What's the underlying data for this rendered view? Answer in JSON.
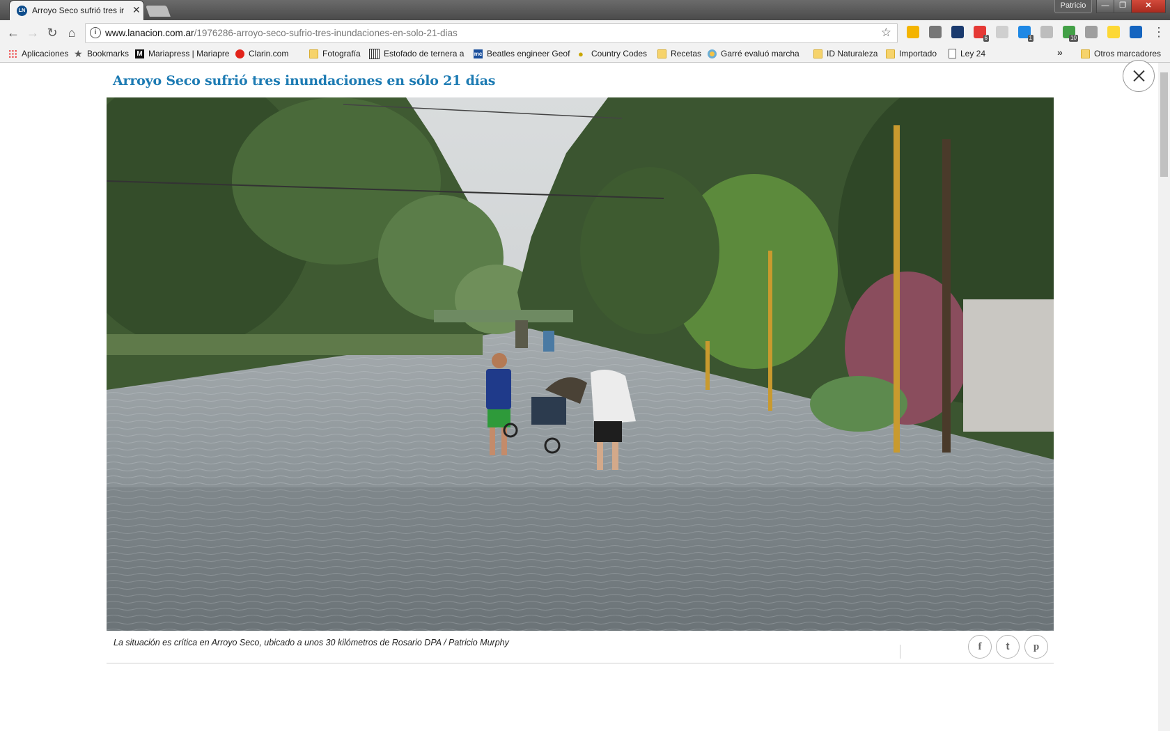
{
  "window": {
    "profile_name": "Patricio",
    "minimize": "—",
    "maximize": "❐",
    "close": "✕"
  },
  "tab": {
    "title": "Arroyo Seco sufrió tres ir",
    "favicon_text": "LN",
    "close_icon": "✕"
  },
  "toolbar": {
    "back": "←",
    "forward": "→",
    "reload": "↻",
    "home": "⌂",
    "star": "☆",
    "menu": "⋮"
  },
  "omnibox": {
    "host": "www.lanacion.com.ar",
    "path": "/1976286-arroyo-seco-sufrio-tres-inundaciones-en-solo-21-dias",
    "info_icon": "i"
  },
  "extensions": [
    {
      "name": "google-drive-ext-icon",
      "color": "#f4b400",
      "badge": ""
    },
    {
      "name": "circle-ext-icon",
      "color": "#777777",
      "badge": ""
    },
    {
      "name": "news-ext-icon",
      "color": "#1a3a6e",
      "badge": ""
    },
    {
      "name": "red-ext-icon",
      "color": "#e53935",
      "badge": "6"
    },
    {
      "name": "camera-ext-icon",
      "color": "#cfcfcf",
      "badge": ""
    },
    {
      "name": "blue-ext-icon",
      "color": "#1e88e5",
      "badge": "1"
    },
    {
      "name": "cloud-ext-icon",
      "color": "#bdbdbd",
      "badge": ""
    },
    {
      "name": "green-ext-icon",
      "color": "#43a047",
      "badge": "10"
    },
    {
      "name": "dropbox-ext-icon",
      "color": "#9e9e9e",
      "badge": ""
    },
    {
      "name": "flag-ext-icon",
      "color": "#fdd835",
      "badge": ""
    },
    {
      "name": "oc-ext-icon",
      "color": "#1565c0",
      "badge": ""
    }
  ],
  "bookmarks": {
    "items": [
      {
        "label": "Aplicaciones",
        "icon": "apps-grid-icon"
      },
      {
        "label": "Bookmarks",
        "icon": "star-icon"
      },
      {
        "label": "Mariapress | Mariapre",
        "icon": "m-logo-icon"
      },
      {
        "label": "Clarin.com",
        "icon": "clarin-logo-icon"
      },
      {
        "label": "Fotografía",
        "icon": "folder-icon"
      },
      {
        "label": "Estofado de ternera a",
        "icon": "recipe-site-icon"
      },
      {
        "label": "Beatles engineer Geof",
        "icon": "mc-logo-icon"
      },
      {
        "label": "Country Codes",
        "icon": "lightbulb-icon"
      },
      {
        "label": "Recetas",
        "icon": "folder-icon"
      },
      {
        "label": "Garré evaluó marcha",
        "icon": "argentina-seal-icon"
      },
      {
        "label": "ID Naturaleza",
        "icon": "folder-icon"
      },
      {
        "label": "Importado",
        "icon": "folder-icon"
      },
      {
        "label": "Ley 24",
        "icon": "page-icon"
      }
    ],
    "more": "»",
    "other": "Otros marcadores"
  },
  "article": {
    "headline": "Arroyo Seco sufrió tres inundaciones en sólo 21 días",
    "caption": "La situación es crítica en Arroyo Seco, ubicado a unos 30 kilómetros de Rosario DPA / Patricio Murphy",
    "photo_alt": "Flooded street in Arroyo Seco with a boy and a person carrying a stroller through the water",
    "share": {
      "facebook": "f",
      "twitter": "t",
      "pinterest": "p"
    }
  },
  "colors": {
    "headline": "#1d7bb3",
    "chrome_toolbar": "#f2f2f2"
  }
}
